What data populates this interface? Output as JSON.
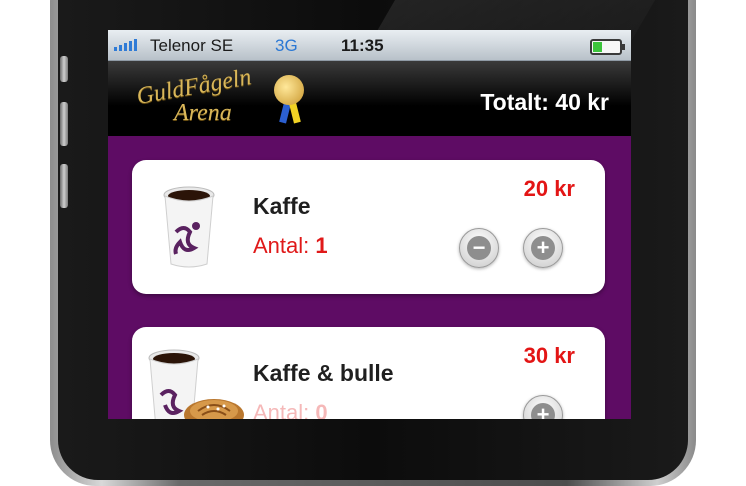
{
  "status_bar": {
    "carrier": "Telenor SE",
    "network": "3G",
    "time": "11:35"
  },
  "header": {
    "logo_line1": "GuldFågeln",
    "logo_line2": "Arena",
    "total": "Totalt: 40 kr"
  },
  "products": [
    {
      "name": "Kaffe",
      "qty_label": "Antal: ",
      "qty": "1",
      "price": "20 kr",
      "icon": "coffee-cup-icon"
    },
    {
      "name": "Kaffe & bulle",
      "qty_label": "Antal: ",
      "qty": "0",
      "price": "30 kr",
      "icon": "coffee-and-bun-icon"
    }
  ],
  "buttons": {
    "minus": "−",
    "plus": "+"
  },
  "colors": {
    "background": "#5e0c64",
    "price": "#e31515",
    "battery": "#3cc43c",
    "network": "#2b78d4",
    "logo_gold": "#d9b75a"
  }
}
